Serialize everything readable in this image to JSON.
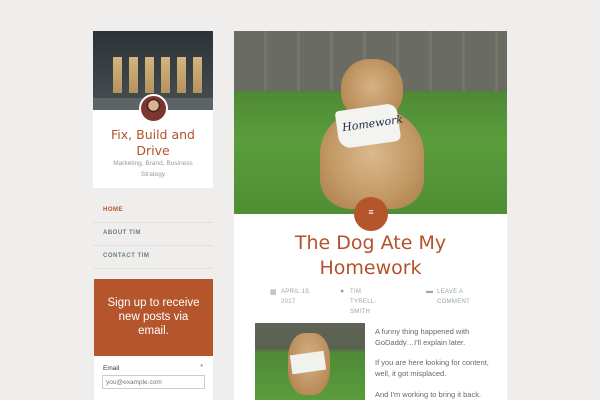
{
  "site": {
    "title": "Fix, Build and Drive",
    "tagline": "Marketing, Brand, Business Strategy"
  },
  "nav": {
    "items": [
      {
        "label": "HOME"
      },
      {
        "label": "ABOUT TIM"
      },
      {
        "label": "CONTACT TIM"
      }
    ]
  },
  "signup": {
    "heading": "Sign up to receive new posts via email.",
    "email_label": "Email",
    "required_marker": "*",
    "email_placeholder": "you@example.com"
  },
  "post": {
    "title": "The Dog Ate My Homework",
    "hero_paper_text": "Homework",
    "date": "APRIL 19, 2017",
    "author": "TIM TYRELL-SMITH",
    "comment_link": "LEAVE A COMMENT",
    "excerpt": [
      "A funny thing happened with GoDaddy…I'll explain later.",
      "If you are here looking for content, well, it got misplaced.",
      "And I'm working to bring it back."
    ]
  },
  "colors": {
    "accent": "#b5552c",
    "background": "#efeeec",
    "nav_text": "#6b7c80"
  },
  "icons": {
    "format_badge": "document-icon",
    "date": "calendar-icon",
    "author": "person-icon",
    "comments": "speech-bubble-icon"
  }
}
